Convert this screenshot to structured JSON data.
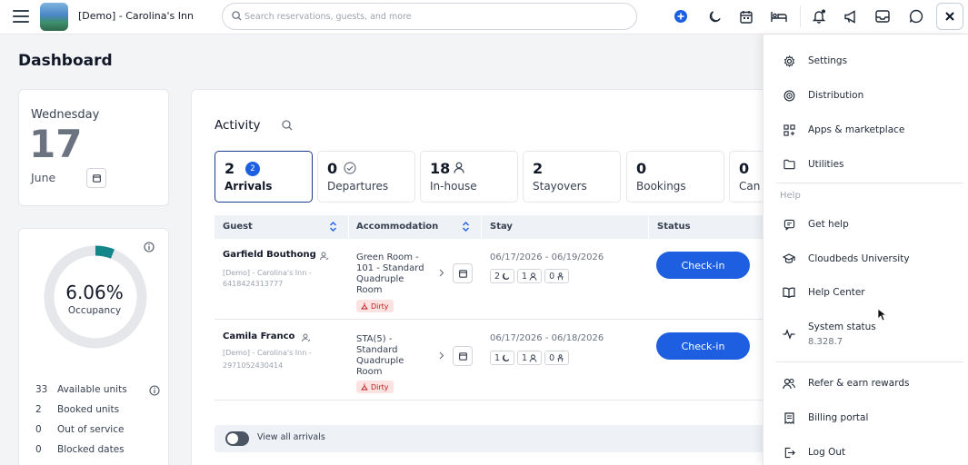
{
  "header": {
    "property_name": "[Demo] - Carolina's Inn",
    "search_placeholder": "Search reservations, guests, and more",
    "icons": [
      "menu-icon",
      "plus-circle-icon",
      "moon-icon",
      "calendar-icon",
      "bed-icon",
      "bell-icon",
      "megaphone-icon",
      "inbox-icon",
      "chat-icon",
      "close-icon"
    ],
    "accent_color": "#1d5fe0"
  },
  "dashboard": {
    "title": "Dashboard",
    "date": {
      "weekday": "Wednesday",
      "day": "17",
      "month": "June"
    },
    "occupancy": {
      "percent_label": "6.06%",
      "percent_value": 6.06,
      "label": "Occupancy",
      "stats": [
        {
          "count": "33",
          "label": "Available units"
        },
        {
          "count": "2",
          "label": "Booked units"
        },
        {
          "count": "0",
          "label": "Out of service"
        },
        {
          "count": "0",
          "label": "Blocked dates"
        }
      ]
    },
    "activity": {
      "title": "Activity",
      "tiles": [
        {
          "count": "2",
          "label": "Arrivals",
          "badge": "2",
          "active": true
        },
        {
          "count": "0",
          "label": "Departures"
        },
        {
          "count": "18",
          "label": "In-house"
        },
        {
          "count": "2",
          "label": "Stayovers"
        },
        {
          "count": "0",
          "label": "Bookings"
        },
        {
          "count": "0",
          "label": "Can"
        }
      ],
      "columns": [
        "Guest",
        "Accommodation",
        "Stay",
        "Status"
      ],
      "rows": [
        {
          "guest_name": "Garfield Bouthong",
          "property": "[Demo] - Carolina's Inn -",
          "reservation_id": "6418424313777",
          "acc_lines": [
            "Green Room -",
            "101 - Standard",
            "Quadruple",
            "Room"
          ],
          "housekeeping": "Dirty",
          "dates": "06/17/2026 - 06/19/2026",
          "nights": "2",
          "adults": "1",
          "children": "0",
          "action": "Check-in"
        },
        {
          "guest_name": "Camila Franco",
          "property": "[Demo] - Carolina's Inn -",
          "reservation_id": "2971052430414",
          "acc_lines": [
            "STA(5) -",
            "Standard",
            "Quadruple",
            "Room"
          ],
          "housekeeping": "Dirty",
          "dates": "06/17/2026 - 06/18/2026",
          "nights": "1",
          "adults": "1",
          "children": "0",
          "action": "Check-in"
        }
      ],
      "view_all_label": "View all arrivals"
    }
  },
  "menu": {
    "items_top": [
      {
        "label": "Settings",
        "icon": "gear-icon"
      },
      {
        "label": "Distribution",
        "icon": "distribution-icon"
      },
      {
        "label": "Apps & marketplace",
        "icon": "apps-grid-icon"
      },
      {
        "label": "Utilities",
        "icon": "folder-icon"
      }
    ],
    "help_heading": "Help",
    "items_help": [
      {
        "label": "Get help",
        "icon": "help-chat-icon"
      },
      {
        "label": "Cloudbeds University",
        "icon": "graduation-cap-icon"
      },
      {
        "label": "Help Center",
        "icon": "book-icon"
      },
      {
        "label": "System status",
        "icon": "pulse-icon"
      }
    ],
    "version": "8.328.7",
    "items_bottom": [
      {
        "label": "Refer & earn rewards",
        "icon": "users-icon"
      },
      {
        "label": "Billing portal",
        "icon": "receipt-icon"
      },
      {
        "label": "Log Out",
        "icon": "logout-icon"
      }
    ]
  }
}
